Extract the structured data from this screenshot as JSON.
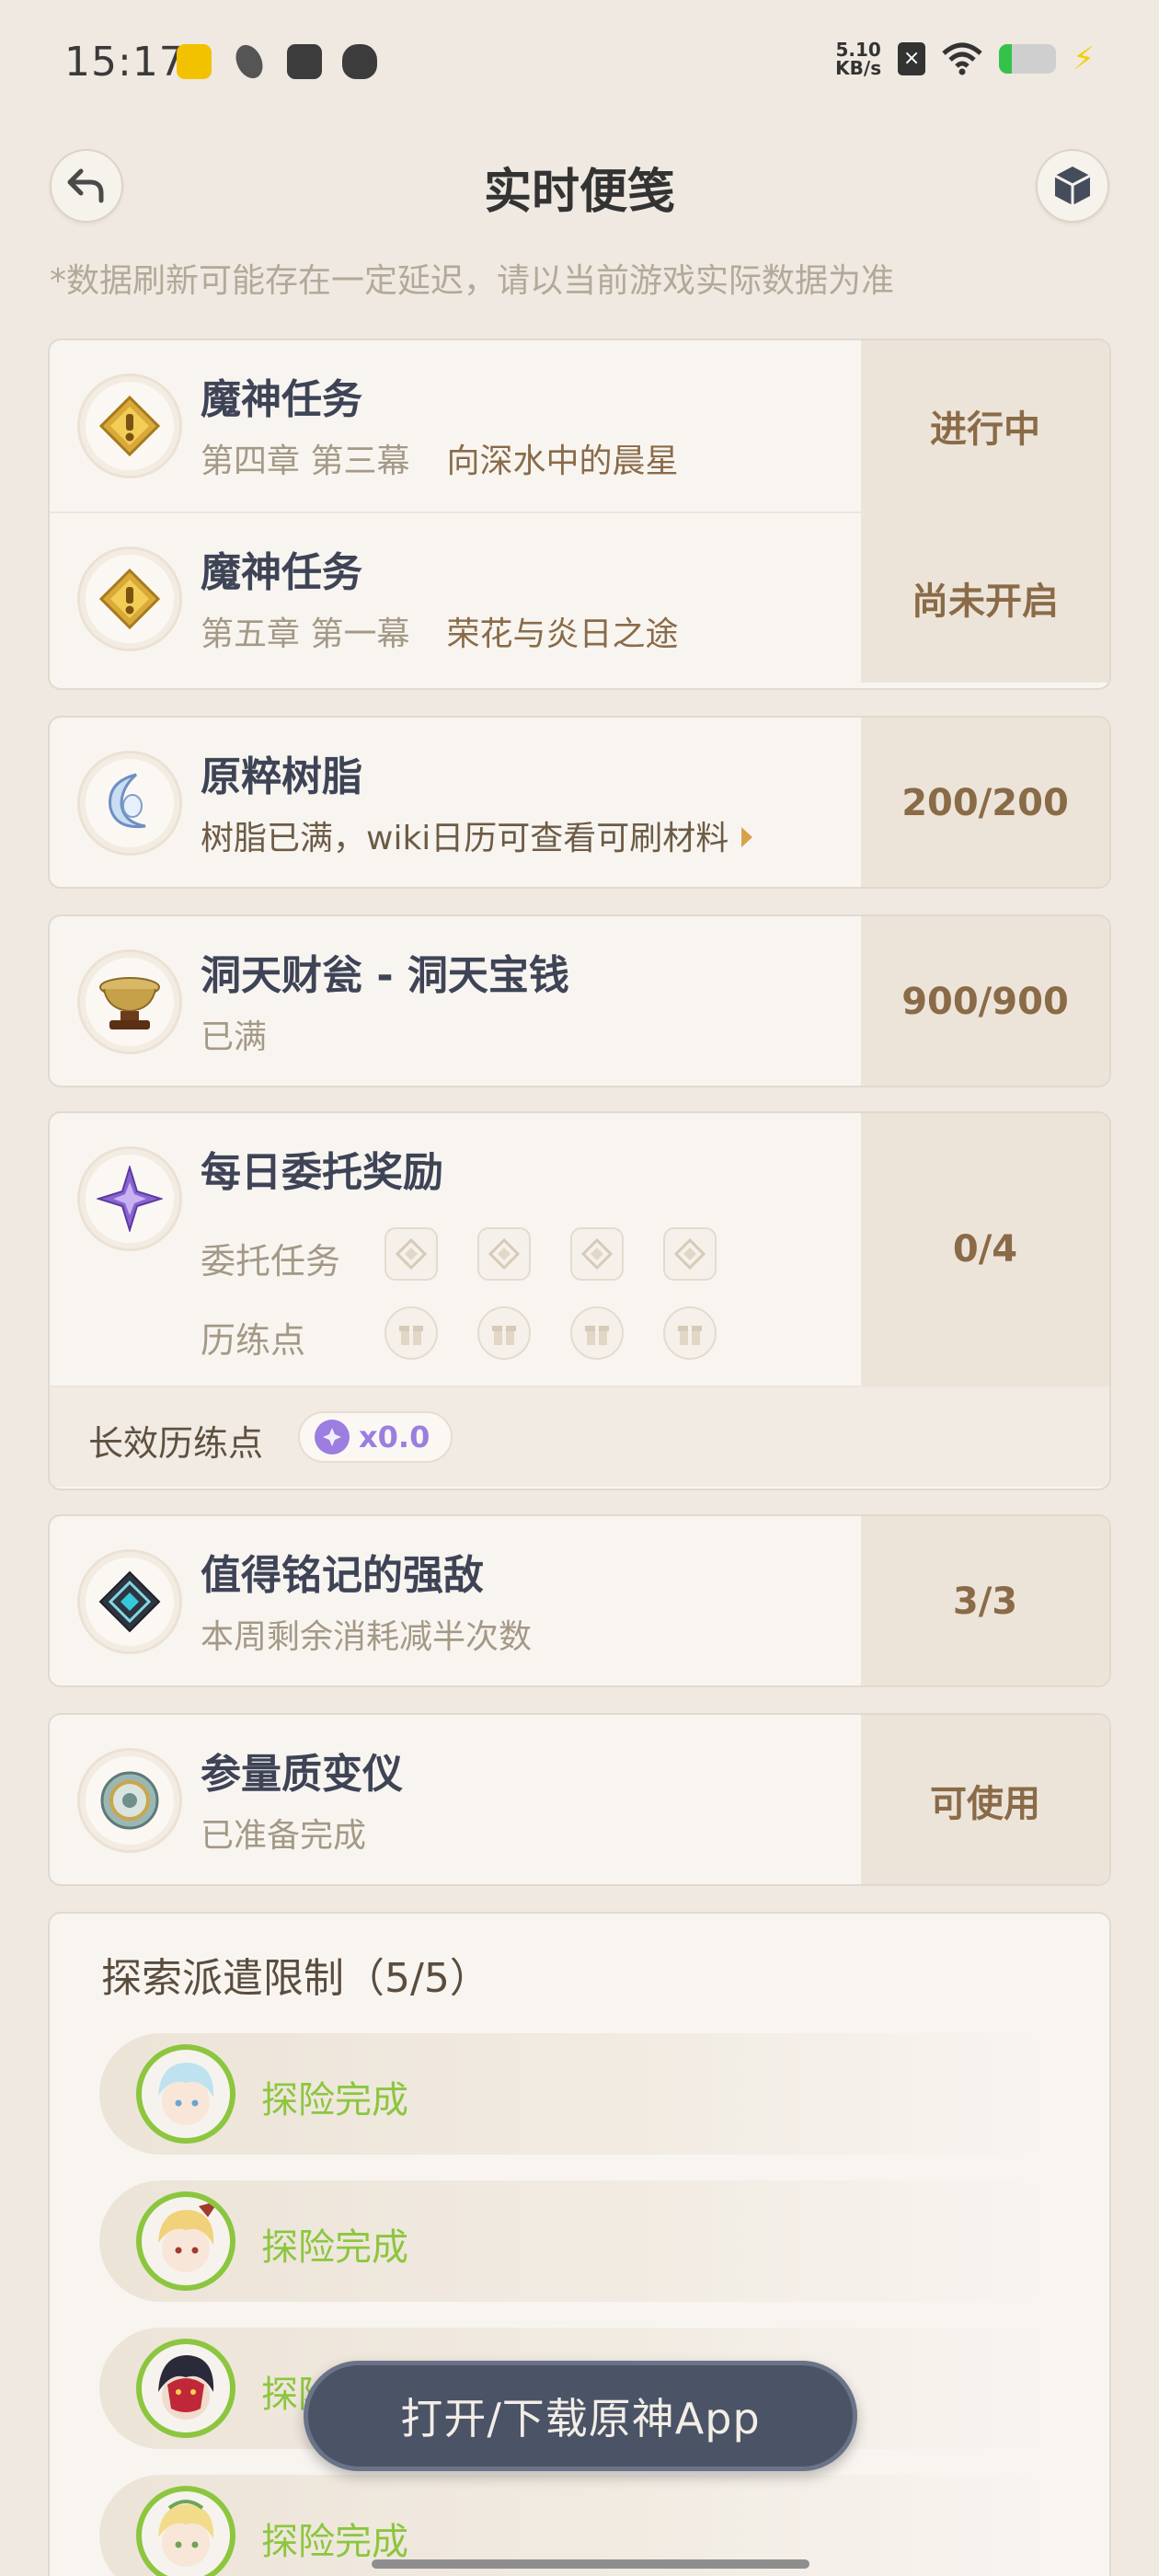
{
  "status_bar": {
    "time": "15:17",
    "net_speed_value": "5.10",
    "net_speed_unit": "KB/s",
    "icons": [
      "app-badge-icon",
      "leaf-app-icon",
      "inbox-app-icon",
      "cat-app-icon",
      "sim-x-icon",
      "wifi-icon",
      "battery-icon",
      "charging-icon"
    ],
    "battery_level": 0.22
  },
  "header": {
    "title": "实时便笺",
    "back_icon": "back-arrow-icon",
    "cube_icon": "cube-icon"
  },
  "notice": "*数据刷新可能存在一定延迟，请以当前游戏实际数据为准",
  "archon_quests": [
    {
      "title": "魔神任务",
      "chapter": "第四章 第三幕",
      "name": "向深水中的晨星",
      "status": "进行中"
    },
    {
      "title": "魔神任务",
      "chapter": "第五章 第一幕",
      "name": "荣花与炎日之途",
      "status": "尚未开启"
    }
  ],
  "resin": {
    "title": "原粹树脂",
    "subtitle": "树脂已满，wiki日历可查看可刷材料",
    "value": "200/200"
  },
  "realm": {
    "title": "洞天财瓮 - 洞天宝钱",
    "subtitle": "已满",
    "value": "900/900"
  },
  "daily": {
    "title": "每日委托奖励",
    "commission_label": "委托任务",
    "exp_label": "历练点",
    "value": "0/4",
    "slots": 4,
    "long_term_label": "长效历练点",
    "long_term_value": "x0.0"
  },
  "weekly_boss": {
    "title": "值得铭记的强敌",
    "subtitle": "本周剩余消耗减半次数",
    "value": "3/3"
  },
  "transformer": {
    "title": "参量质变仪",
    "subtitle": "已准备完成",
    "value": "可使用"
  },
  "expedition": {
    "title": "探索派遣限制（5/5）",
    "items": [
      {
        "status": "探险完成",
        "hair": "#bfe3ee",
        "accent": "#6aa7c9"
      },
      {
        "status": "探险完成",
        "hair": "#f1d27a",
        "accent": "#a33a2e"
      },
      {
        "status": "探险完成",
        "hair": "#2a2a3a",
        "accent": "#c0283a"
      },
      {
        "status": "探险完成",
        "hair": "#f2dc8a",
        "accent": "#6fa35a"
      }
    ]
  },
  "open_app_button": "打开/下载原神App",
  "colors": {
    "background": "#efe9e1",
    "value_text": "#8a6b48",
    "complete_green": "#8cc63f",
    "purple": "#9b7ee0"
  }
}
